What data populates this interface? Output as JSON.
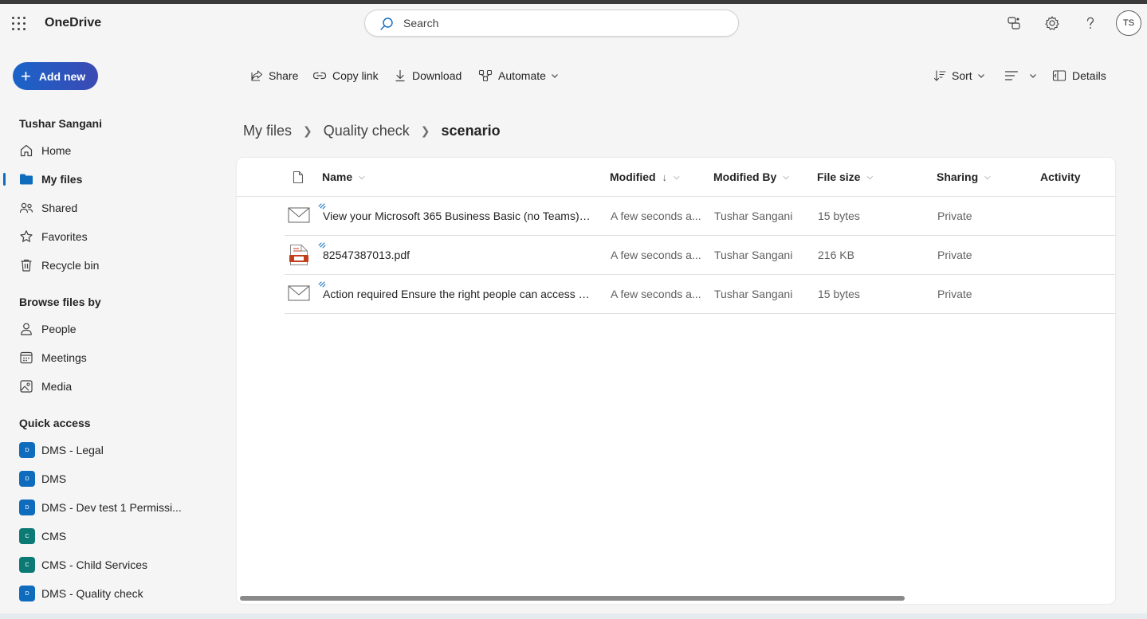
{
  "app": {
    "name": "OneDrive"
  },
  "search": {
    "placeholder": "Search"
  },
  "user": {
    "initials": "TS",
    "name": "Tushar Sangani"
  },
  "add_new": {
    "label": "Add new"
  },
  "sidebar": {
    "main_items": [
      {
        "label": "Home",
        "icon": "home-icon"
      },
      {
        "label": "My files",
        "icon": "folder-icon",
        "active": true
      },
      {
        "label": "Shared",
        "icon": "people-icon"
      },
      {
        "label": "Favorites",
        "icon": "star-icon"
      },
      {
        "label": "Recycle bin",
        "icon": "trash-icon"
      }
    ],
    "browse_heading": "Browse files by",
    "browse_items": [
      {
        "label": "People",
        "icon": "person-icon"
      },
      {
        "label": "Meetings",
        "icon": "calendar-icon"
      },
      {
        "label": "Media",
        "icon": "image-icon"
      }
    ],
    "quick_heading": "Quick access",
    "quick_items": [
      {
        "label": "DMS - Legal",
        "letter": "D",
        "color": "#0f6cbd"
      },
      {
        "label": "DMS",
        "letter": "D",
        "color": "#0f6cbd"
      },
      {
        "label": "DMS - Dev test 1 Permissi...",
        "letter": "D",
        "color": "#0f6cbd"
      },
      {
        "label": "CMS",
        "letter": "C",
        "color": "#0b7a75"
      },
      {
        "label": "CMS - Child Services",
        "letter": "C",
        "color": "#0b7a75"
      },
      {
        "label": "DMS - Quality check",
        "letter": "D",
        "color": "#0f6cbd"
      }
    ]
  },
  "commands": {
    "share": "Share",
    "copy_link": "Copy link",
    "download": "Download",
    "automate": "Automate",
    "sort": "Sort",
    "details": "Details"
  },
  "breadcrumb": [
    "My files",
    "Quality check",
    "scenario"
  ],
  "columns": {
    "name": "Name",
    "modified": "Modified",
    "modified_by": "Modified By",
    "file_size": "File size",
    "sharing": "Sharing",
    "activity": "Activity"
  },
  "files": [
    {
      "name": "View your Microsoft 365 Business Basic (no Teams) i...",
      "type": "email",
      "modified": "A few seconds a...",
      "modified_by": "Tushar Sangani",
      "size": "15 bytes",
      "sharing": "Private"
    },
    {
      "name": "82547387013.pdf",
      "type": "pdf",
      "modified": "A few seconds a...",
      "modified_by": "Tushar Sangani",
      "size": "216 KB",
      "sharing": "Private"
    },
    {
      "name": "Action required Ensure the right people can access s...",
      "type": "email",
      "modified": "A few seconds a...",
      "modified_by": "Tushar Sangani",
      "size": "15 bytes",
      "sharing": "Private"
    }
  ],
  "colors": {
    "accent": "#0f6cbd",
    "pdf": "#c43e1c"
  }
}
